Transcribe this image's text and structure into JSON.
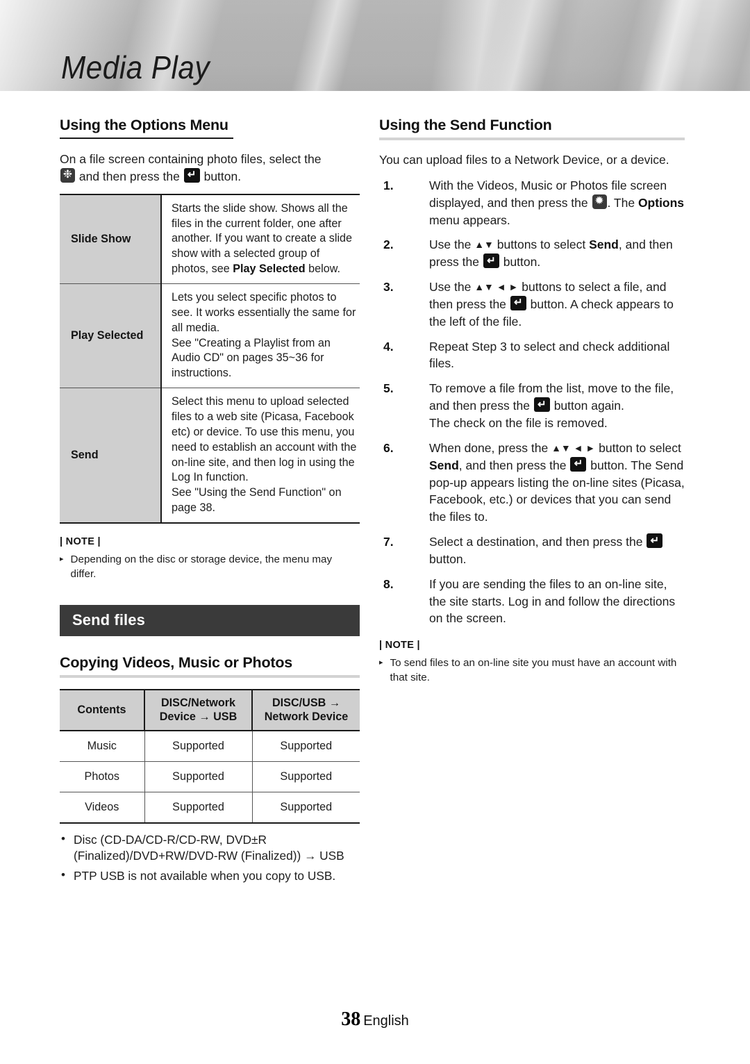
{
  "header": {
    "title": "Media Play"
  },
  "icons": {
    "tools": "gear-tools-button-icon",
    "enter": "enter-return-button-icon",
    "updown": "▲▼",
    "updownleftright": "▲▼◄►",
    "arrow_right": "→",
    "note_bullet": "▸",
    "dot_bullet": "•"
  },
  "left": {
    "options_heading": "Using the Options Menu",
    "options_intro_a": "On a file screen containing photo files, select the",
    "options_intro_b": "and then press the",
    "options_intro_c": "button.",
    "options_table": [
      {
        "key": "Slide Show",
        "value": "Starts the slide show. Shows all the files in the current folder, one after another. If you want to create a slide show with a selected group of photos, see ",
        "value_bold": "Play Selected",
        "value_tail": " below."
      },
      {
        "key": "Play Selected",
        "value": "Lets you select specific photos to see. It works essentially the same for all media.",
        "value_line2": "See \"Creating a Playlist from an Audio CD\" on pages 35~36 for instructions."
      },
      {
        "key": "Send",
        "value": "Select this menu to upload selected files to a web site (Picasa, Facebook etc) or device. To use this menu, you need to establish an account with the on-line site, and then log in using the Log In function.",
        "value_line2": "See \"Using the Send Function\" on page 38."
      }
    ],
    "note_label": "| NOTE |",
    "note_items": [
      "Depending on the disc or storage device, the menu may differ."
    ],
    "section_bar": "Send files",
    "copy_heading": "Copying Videos, Music or Photos",
    "copy_table": {
      "headers": [
        "Contents",
        "DISC/Network Device → USB",
        "DISC/USB → Network Device"
      ],
      "header_lines": [
        [
          "Contents"
        ],
        [
          "DISC/Network",
          "Device → USB"
        ],
        [
          "DISC/USB →",
          "Network Device"
        ]
      ],
      "rows": [
        [
          "Music",
          "Supported",
          "Supported"
        ],
        [
          "Photos",
          "Supported",
          "Supported"
        ],
        [
          "Videos",
          "Supported",
          "Supported"
        ]
      ]
    },
    "copy_bullets": [
      "Disc (CD-DA/CD-R/CD-RW, DVD±R (Finalized)/DVD+RW/DVD-RW (Finalized)) → USB",
      "PTP USB is not available when you copy to USB."
    ]
  },
  "right": {
    "send_heading": "Using the Send Function",
    "send_intro": "You can upload files to a Network Device, or a device.",
    "steps": [
      {
        "n": "1.",
        "parts": [
          "With the Videos, Music or Photos file screen displayed, and then press the ",
          "ICON_TOOLS",
          ". The ",
          "BOLD:Options",
          " menu appears."
        ]
      },
      {
        "n": "2.",
        "parts": [
          "Use the ",
          "ARROWS:▲▼",
          " buttons to select ",
          "BOLD:Send",
          ", and then press the ",
          "ICON_ENTER",
          " button."
        ]
      },
      {
        "n": "3.",
        "parts": [
          "Use the ",
          "ARROWS:▲▼ ◄ ►",
          " buttons to select a file, and then press the ",
          "ICON_ENTER",
          " button. A check appears to the left of the file."
        ]
      },
      {
        "n": "4.",
        "parts": [
          "Repeat Step 3 to select and check additional files."
        ]
      },
      {
        "n": "5.",
        "parts": [
          "To remove a file from the list, move to the file, and then press the ",
          "ICON_ENTER",
          " button again.",
          "BR",
          "The check on the file is removed."
        ]
      },
      {
        "n": "6.",
        "parts": [
          "When done, press the ",
          "ARROWS:▲▼ ◄ ►",
          " button to select ",
          "BOLD:Send",
          ", and then press the ",
          "ICON_ENTER",
          " button. The Send pop-up appears listing the on-line sites (Picasa, Facebook, etc.) or devices that you can send the files to."
        ]
      },
      {
        "n": "7.",
        "parts": [
          "Select a destination, and then press the ",
          "ICON_ENTER",
          " button."
        ]
      },
      {
        "n": "8.",
        "parts": [
          "If you are sending the files to an on-line site, the site starts. Log in and follow the directions on the screen."
        ]
      }
    ],
    "note_label": "| NOTE |",
    "note_items": [
      "To send files to an on-line site you must have an account with that site."
    ]
  },
  "footer": {
    "page": "38",
    "language": "English"
  },
  "colors": {
    "bar_bg": "#3a3a3a",
    "table_key_bg": "#cfcfcf",
    "rule_light": "#d3d3d3",
    "rule_dark": "#1a1a1a",
    "banner_gray": "#d2d2d2"
  }
}
